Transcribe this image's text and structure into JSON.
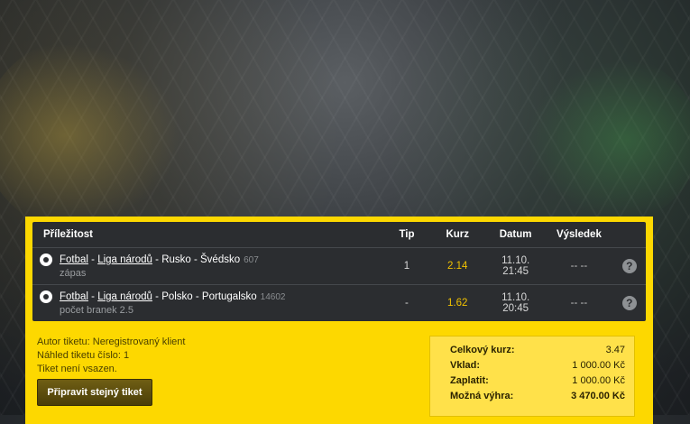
{
  "table": {
    "headers": {
      "event": "Příležitost",
      "tip": "Tip",
      "odds": "Kurz",
      "date": "Datum",
      "result": "Výsledek"
    },
    "rows": [
      {
        "sport": "Fotbal",
        "league": "Liga národů",
        "match": "Rusko - Švédsko",
        "event_id": "607",
        "market": "zápas",
        "tip": "1",
        "odds": "2.14",
        "date": "11.10. 21:45",
        "result": "-- --",
        "help": "?"
      },
      {
        "sport": "Fotbal",
        "league": "Liga národů",
        "match": "Polsko - Portugalsko",
        "event_id": "14602",
        "market": "počet branek 2.5",
        "tip": "-",
        "odds": "1.62",
        "date": "11.10. 20:45",
        "result": "-- --",
        "help": "?"
      }
    ]
  },
  "ticket_info": {
    "author": "Autor tiketu: Neregistrovaný klient",
    "preview": "Náhled tiketu číslo: 1",
    "status": "Tiket není vsazen."
  },
  "buttons": {
    "prepare_same": "Připravit stejný tiket"
  },
  "summary": {
    "total_odds_label": "Celkový kurz:",
    "total_odds": "3.47",
    "stake_label": "Vklad:",
    "stake": "1 000.00 Kč",
    "pay_label": "Zaplatit:",
    "pay": "1 000.00 Kč",
    "win_label": "Možná výhra:",
    "win": "3 470.00 Kč"
  },
  "icons": {
    "sport": "soccer-ball-icon",
    "help": "question-icon"
  },
  "colors": {
    "panel": "#fdd800",
    "table": "#2b2d30",
    "odds": "#f2c200"
  }
}
